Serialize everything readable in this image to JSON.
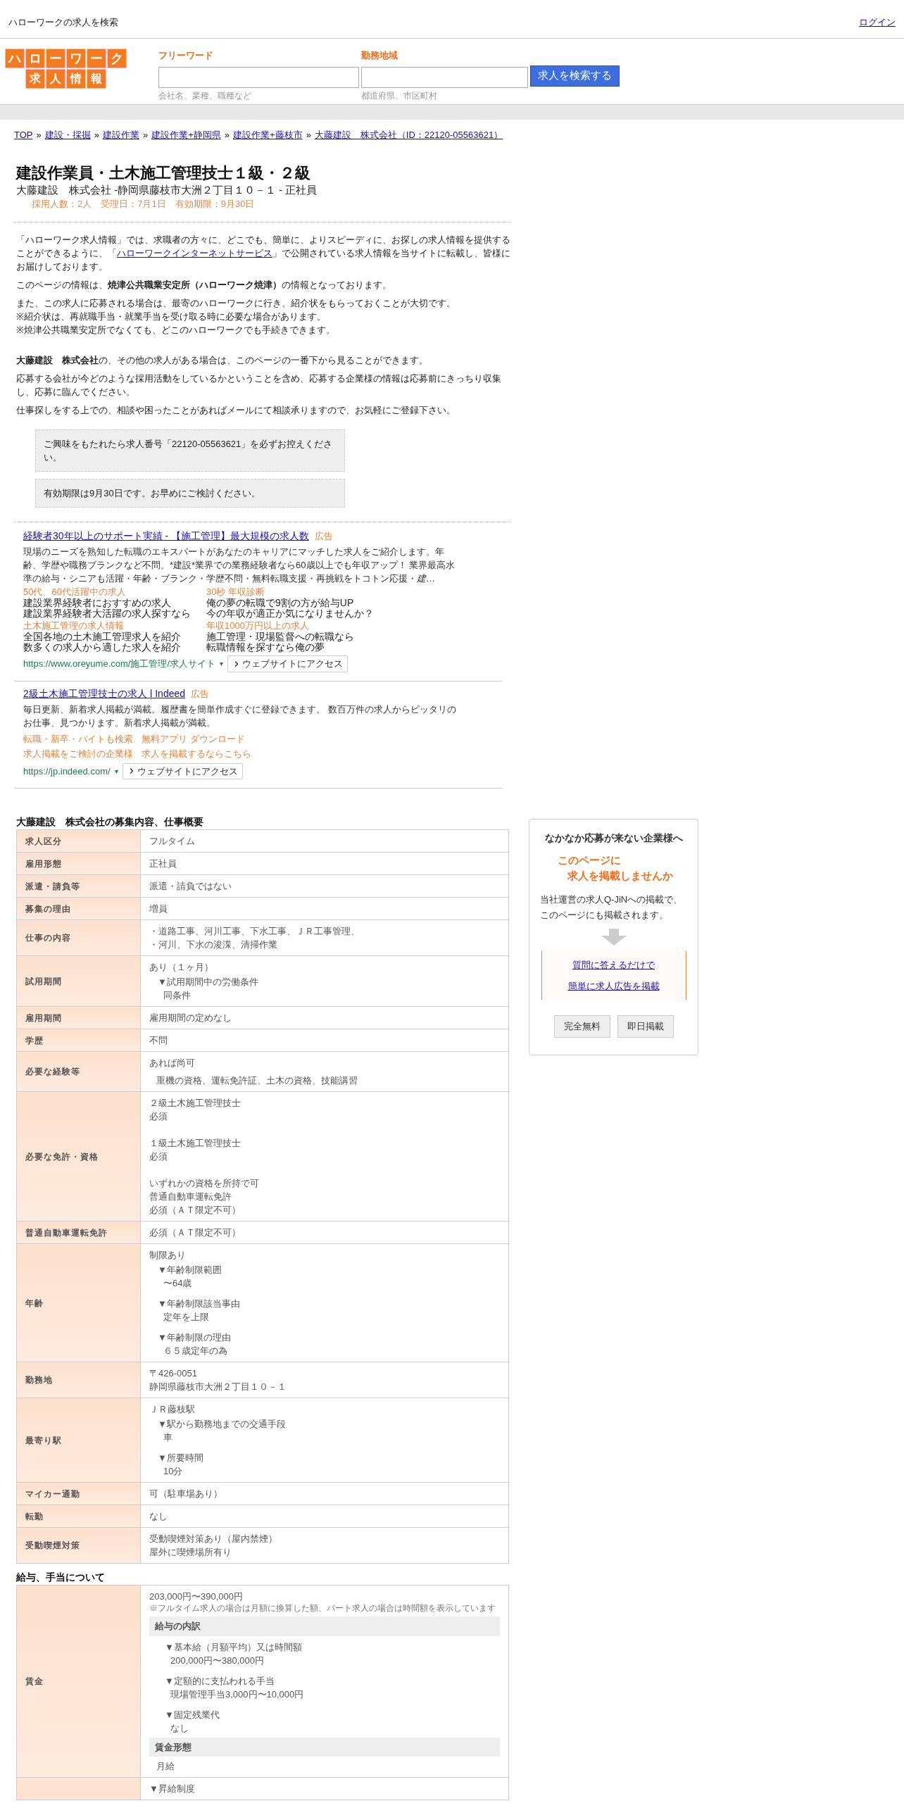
{
  "top_bar": {
    "title": "ハローワークの求人を検索",
    "login": "ログイン"
  },
  "logo": {
    "line1": "ハローワーク",
    "line2": "求人情報"
  },
  "search": {
    "fields": [
      {
        "label": "フリーワード",
        "hint": "会社名、業種、職種など"
      },
      {
        "label": "勤務地域",
        "hint": "都道府県、市区町村"
      }
    ],
    "button": "求人を検索する"
  },
  "breadcrumb": {
    "separator": "»",
    "items": [
      "TOP",
      "建設・採掘",
      "建設作業",
      "建設作業+静岡県",
      "建設作業+藤枝市",
      "大藤建設　株式会社（ID：22120-05563621）"
    ]
  },
  "job": {
    "title": "建設作業員・土木施工管理技士１級・２級",
    "subtitle": "大藤建設　株式会社 -静岡県藤枝市大洲２丁目１０－１ - 正社員",
    "meta": "採用人数：2人　受理日：7月1日　有効期限：9月30日"
  },
  "intro": [
    {
      "lines": [
        [
          {
            "kind": "text",
            "text": "「ハローワーク求人情報」では、求職者の方々に、どこでも、簡単に、よりスピーディに、お探しの求人情報を提供することができるように、「"
          },
          {
            "kind": "link",
            "text": "ハローワークインターネットサービス"
          },
          {
            "kind": "text",
            "text": "」で公開されている求人情報を当サイトに転載し、皆様にお届けしております。"
          }
        ]
      ]
    },
    {
      "lines": [
        [
          {
            "kind": "text",
            "text": "このページの情報は、**焼津公共職業安定所（ハローワーク焼津）**の情報となっております。"
          }
        ]
      ]
    },
    {
      "lines": [
        [
          {
            "kind": "text",
            "text": "また、この求人に応募される場合は、最寄のハローワークに行き、紹介状をもらっておくことが大切です。"
          }
        ],
        [
          {
            "kind": "text",
            "text": "※紹介状は、再就職手当・就業手当を受け取る時に必要な場合があります。"
          }
        ],
        [
          {
            "kind": "text",
            "text": "※焼津公共職業安定所でなくても、どこのハローワークでも手続きできます。"
          }
        ]
      ]
    },
    {
      "lines": [
        [
          {
            "kind": "text",
            "text": "**大藤建設　株式会社**の、その他の求人がある場合は、このページの一番下から見ることができます。"
          }
        ]
      ]
    },
    {
      "lines": [
        [
          {
            "kind": "text",
            "text": "応募する会社が今どのような採用活動をしているかということを含め、応募する企業様の情報は応募前にきっちり収集し、応募に臨んでください。"
          }
        ]
      ]
    },
    {
      "lines": [
        [
          {
            "kind": "text",
            "text": "仕事探しをする上での、相談や困ったことがあればメールにて相談承りますので、お気軽にご登録下さい。"
          }
        ]
      ]
    }
  ],
  "notices": [
    "ご興味をもたれたら求人番号「22120-05563621」を必ずお控えください。",
    "有効期限は9月30日です。お早めにご検討ください。"
  ],
  "ads": [
    {
      "title": "経験者30年以上のサポート実績 - 【施工管理】最大規模の求人数",
      "badge": "広告",
      "description": "現場のニーズを熟知した転職のエキスパートがあなたのキャリアにマッチした求人をご紹介します。年齢、学歴や職務ブランクなど不問。*建設*業界での業務経験者なら60歳以上でも年収アップ！ 業界最高水準の給与・シニアも活躍・年齢・ブランク・学歴不問・無料転職支援・再挑戦をトコトン応援・*建*…",
      "sitelinks": [
        {
          "title": "50代、60代活躍中の求人",
          "lines": [
            "建設業界経験者におすすめの求人",
            "建設業界経験者大活躍の求人探すなら"
          ]
        },
        {
          "title": "30秒 年収診断",
          "lines": [
            "俺の夢の転職で9割の方が給与UP",
            "今の年収が適正か気になりませんか？"
          ]
        },
        {
          "title": "土木施工管理の求人情報",
          "lines": [
            "全国各地の土木施工管理求人を紹介",
            "数多くの求人から適した求人を紹介"
          ]
        },
        {
          "title": "年収1000万円以上の求人",
          "lines": [
            "施工管理・現場監督への転職なら",
            "転職情報を探すなら俺の夢"
          ]
        }
      ],
      "url": "https://www.oreyume.com/施工管理/求人サイト",
      "url_mark": "▾",
      "button": "ウェブサイトにアクセス"
    },
    {
      "title": "2級土木施工管理技士の求人 | Indeed",
      "badge": "広告",
      "description": "毎日更新、新着求人掲載が満載。履歴書を簡単作成すぐに登録できます。 数百万件の求人からピッタリのお仕事、見つかります。新着求人掲載が満載。",
      "links": [
        "転職・新卒・バイトも検索",
        "無料アプリ ダウンロード",
        "求人掲載をご検討の企業様",
        "求人を掲載するならこちら"
      ],
      "url": "https://jp.indeed.com/",
      "url_mark": "▾",
      "button": "ウェブサイトにアクセス"
    }
  ],
  "sections": [
    {
      "title": "大藤建設　株式会社の募集内容、仕事概要",
      "rows": [
        {
          "label": "求人区分",
          "lines": [
            {
              "kind": "text",
              "text": "フルタイム"
            }
          ]
        },
        {
          "label": "雇用形態",
          "lines": [
            {
              "kind": "text",
              "text": "正社員"
            }
          ]
        },
        {
          "label": "派遣・請負等",
          "lines": [
            {
              "kind": "text",
              "text": "派遣・請負ではない"
            }
          ]
        },
        {
          "label": "募集の理由",
          "lines": [
            {
              "kind": "text",
              "text": "増員"
            }
          ]
        },
        {
          "label": "仕事の内容",
          "lines": [
            {
              "kind": "text",
              "text": "・道路工事、河川工事、下水工事、ＪＲ工事管理、"
            },
            {
              "kind": "text",
              "text": "・河川、下水の浚渫、清掃作業"
            }
          ]
        },
        {
          "label": "試用期間",
          "lines": [
            {
              "kind": "text",
              "text": "あり（１ヶ月）"
            },
            {
              "kind": "head",
              "text": "▼試用期間中の労働条件"
            },
            {
              "kind": "body",
              "text": "同条件"
            }
          ]
        },
        {
          "label": "雇用期間",
          "lines": [
            {
              "kind": "text",
              "text": "雇用期間の定めなし"
            }
          ]
        },
        {
          "label": "学歴",
          "lines": [
            {
              "kind": "text",
              "text": "不問"
            }
          ]
        },
        {
          "label": "必要な経験等",
          "lines": [
            {
              "kind": "text",
              "text": "あれば尚可"
            },
            {
              "kind": "detail",
              "text": "重機の資格、運転免許証、土木の資格、技能講習"
            }
          ]
        },
        {
          "label": "必要な免許・資格",
          "lines": [
            {
              "kind": "text",
              "text": "２級土木施工管理技士"
            },
            {
              "kind": "text",
              "text": "必須"
            },
            {
              "kind": "spaced",
              "text": "１級土木施工管理技士"
            },
            {
              "kind": "text",
              "text": "必須"
            },
            {
              "kind": "spaced",
              "text": "いずれかの資格を所持で可"
            },
            {
              "kind": "text",
              "text": "普通自動車運転免許"
            },
            {
              "kind": "text",
              "text": "必須（ＡＴ限定不可）"
            }
          ]
        },
        {
          "label": "普通自動車運転免許",
          "lines": [
            {
              "kind": "text",
              "text": "必須（ＡＴ限定不可）"
            }
          ]
        },
        {
          "label": "年齢",
          "lines": [
            {
              "kind": "text",
              "text": "制限あり"
            },
            {
              "kind": "head",
              "text": "▼年齢制限範囲"
            },
            {
              "kind": "body",
              "text": "〜64歳"
            },
            {
              "kind": "head",
              "text": "▼年齢制限該当事由"
            },
            {
              "kind": "body",
              "text": "定年を上限"
            },
            {
              "kind": "head",
              "text": "▼年齢制限の理由"
            },
            {
              "kind": "body",
              "text": "６５歳定年の為"
            }
          ]
        },
        {
          "label": "勤務地",
          "lines": [
            {
              "kind": "text",
              "text": "〒426-0051"
            },
            {
              "kind": "text",
              "text": "静岡県藤枝市大洲２丁目１０－１"
            }
          ]
        },
        {
          "label": "最寄り駅",
          "lines": [
            {
              "kind": "text",
              "text": "ＪＲ藤枝駅"
            },
            {
              "kind": "head",
              "text": "▼駅から勤務地までの交通手段"
            },
            {
              "kind": "body",
              "text": "車"
            },
            {
              "kind": "head",
              "text": "▼所要時間"
            },
            {
              "kind": "body",
              "text": "10分"
            }
          ]
        },
        {
          "label": "マイカー通勤",
          "lines": [
            {
              "kind": "text",
              "text": "可（駐車場あり）"
            }
          ]
        },
        {
          "label": "転勤",
          "lines": [
            {
              "kind": "text",
              "text": "なし"
            }
          ]
        },
        {
          "label": "受動喫煙対策",
          "lines": [
            {
              "kind": "text",
              "text": "受動喫煙対策あり（屋内禁煙）"
            },
            {
              "kind": "text",
              "text": "屋外に喫煙場所有り"
            }
          ]
        }
      ]
    },
    {
      "title": "給与、手当について",
      "rows": [
        {
          "label": "賃金",
          "lines": [
            {
              "kind": "text",
              "text": "203,000円〜390,000円"
            },
            {
              "kind": "note",
              "text": "※フルタイム求人の場合は月額に換算した額、パート求人の場合は時間額を表示しています"
            },
            {
              "kind": "section",
              "text": "給与の内訳"
            },
            {
              "kind": "subhead",
              "text": "▼基本給（月額平均）又は時間額"
            },
            {
              "kind": "subbody",
              "text": "200,000円〜380,000円"
            },
            {
              "kind": "subhead",
              "text": "▼定額的に支払われる手当"
            },
            {
              "kind": "subbody",
              "text": "現場管理手当3,000円〜10,000円"
            },
            {
              "kind": "subhead",
              "text": "▼固定残業代"
            },
            {
              "kind": "subbody",
              "text": "なし"
            },
            {
              "kind": "section",
              "text": "賃金形態"
            },
            {
              "kind": "sub",
              "text": "月給"
            }
          ]
        },
        {
          "lines": [
            {
              "kind": "text",
              "text": "▼昇給制度"
            }
          ]
        }
      ]
    }
  ],
  "sidebar": {
    "title": "なかなか応募が来ない企業様へ",
    "catch": [
      "このページに",
      "求人を掲載しませんか"
    ],
    "body": [
      "当社運営の求人Q-JiNへの掲載で、",
      "このページにも掲載されます。"
    ],
    "links": [
      "質問に答えるだけで",
      "簡単に求人広告を掲載"
    ],
    "tags": [
      "完全無料",
      "即日掲載"
    ]
  }
}
